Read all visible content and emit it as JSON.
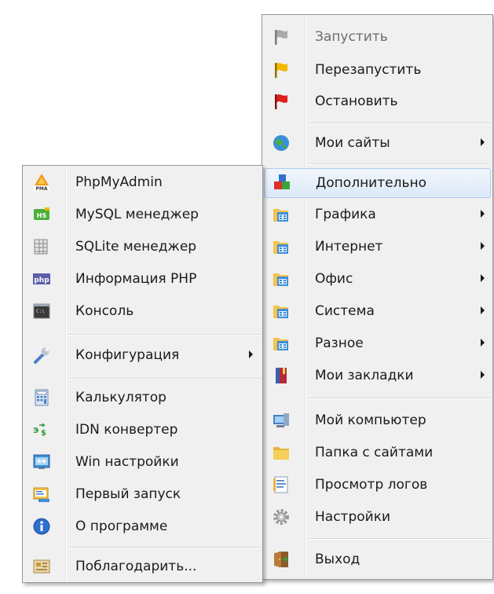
{
  "main_menu": {
    "items": [
      {
        "label": "Запустить",
        "icon": "gray-flag-icon",
        "disabled": true
      },
      {
        "label": "Перезапустить",
        "icon": "yellow-flag-icon"
      },
      {
        "label": "Остановить",
        "icon": "red-flag-icon"
      },
      {
        "label": "Мои сайты",
        "icon": "globe-icon",
        "submenu": true
      },
      {
        "label": "Дополнительно",
        "icon": "extras-cubes-icon",
        "highlighted": true
      },
      {
        "label": "Графика",
        "icon": "folder-app-icon",
        "submenu": true
      },
      {
        "label": "Интернет",
        "icon": "folder-app-icon",
        "submenu": true
      },
      {
        "label": "Офис",
        "icon": "folder-app-icon",
        "submenu": true
      },
      {
        "label": "Система",
        "icon": "folder-app-icon",
        "submenu": true
      },
      {
        "label": "Разное",
        "icon": "folder-app-icon",
        "submenu": true
      },
      {
        "label": "Мои закладки",
        "icon": "bookmarks-book-icon",
        "submenu": true
      },
      {
        "label": "Мой компьютер",
        "icon": "computer-icon"
      },
      {
        "label": "Папка с сайтами",
        "icon": "folder-icon"
      },
      {
        "label": "Просмотр логов",
        "icon": "log-document-icon"
      },
      {
        "label": "Настройки",
        "icon": "gear-icon"
      },
      {
        "label": "Выход",
        "icon": "exit-door-icon"
      }
    ]
  },
  "sub_menu": {
    "items": [
      {
        "label": "PhpMyAdmin",
        "icon": "phpmyadmin-icon"
      },
      {
        "label": "MySQL менеджер",
        "icon": "heidisql-icon"
      },
      {
        "label": "SQLite менеджер",
        "icon": "sqlite-icon"
      },
      {
        "label": "Информация PHP",
        "icon": "php-icon"
      },
      {
        "label": "Консоль",
        "icon": "console-icon"
      },
      {
        "label": "Конфигурация",
        "icon": "wrench-icon",
        "submenu": true
      },
      {
        "label": "Калькулятор",
        "icon": "calculator-icon"
      },
      {
        "label": "IDN конвертер",
        "icon": "idn-converter-icon"
      },
      {
        "label": "Win настройки",
        "icon": "win-settings-icon"
      },
      {
        "label": "Первый запуск",
        "icon": "first-run-icon"
      },
      {
        "label": "О программе",
        "icon": "info-icon"
      },
      {
        "label": "Поблагодарить...",
        "icon": "thanks-icon"
      }
    ]
  },
  "colors": {
    "menu_bg": "#f0f0f0",
    "highlight": "#dce9f8",
    "highlight_border": "#aecbf0"
  }
}
